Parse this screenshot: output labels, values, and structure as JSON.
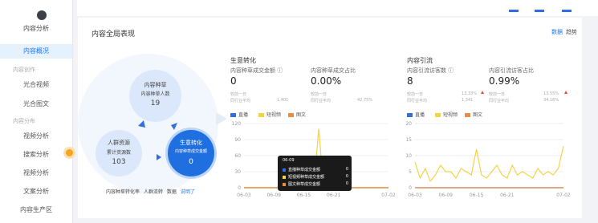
{
  "sidebar": {
    "logo_text": "内容分析",
    "items": [
      {
        "label": "内容概况",
        "active": true
      },
      {
        "group": "内容创作"
      },
      {
        "label": "光合视频"
      },
      {
        "label": "光合图文"
      },
      {
        "group": "内容分布"
      },
      {
        "label": "视频分析"
      },
      {
        "label": "搜索分析"
      },
      {
        "label": "视频分析"
      },
      {
        "label": "文案分析"
      },
      {
        "label": "内容生产区"
      }
    ]
  },
  "card": {
    "title": "内容全局表现",
    "toggle_primary": "数据",
    "toggle_secondary": "趋势"
  },
  "funnel": {
    "top": {
      "title": "内容种草",
      "subtitle": "内容种草人数",
      "value": "19"
    },
    "left": {
      "title": "人群资源",
      "subtitle": "累计资源数",
      "value": "103"
    },
    "right": {
      "title": "生意转化",
      "subtitle": "内容种草成交金额",
      "value": "0"
    },
    "footer_a": "内容种草转化率",
    "footer_b": "人群流转",
    "footer_c": "数据",
    "footer_link": "说明了"
  },
  "left_panel": {
    "section_title": "生意转化",
    "metric1_label": "内容种草成交金额 ⓘ",
    "metric1_value": "0",
    "metric2_label": "内容种草成交占比",
    "metric2_value": "0.00%",
    "sub1a": "较前一日",
    "sub1b": "同行业平均",
    "sub1c": "1,401",
    "sub2a": "较前一日",
    "sub2b": "同行业平均",
    "sub2c": "42.75%",
    "legend": [
      "直播",
      "短视频",
      "图文"
    ],
    "yticks": [
      "120",
      "90",
      "60",
      "30",
      "0"
    ],
    "xticks": [
      "06-03",
      "06-09",
      "06-15",
      "06-21",
      "07-02"
    ]
  },
  "right_panel": {
    "section_title": "内容引流",
    "metric1_label": "内容引流访客数 ⓘ",
    "metric1_value": "8",
    "metric2_label": "内容引流访客占比",
    "metric2_value": "0.99%",
    "sub1a": "较前一日",
    "sub1b": "同行业平均",
    "sub1c": "13.33%",
    "sub1d": "1,341",
    "sub2a": "较前一日",
    "sub2b": "同行业平均",
    "sub2c": "13.55%",
    "sub2d": "34.16%",
    "legend": [
      "直播",
      "短视频",
      "图文"
    ],
    "yticks": [
      "20",
      "15",
      "10",
      "5",
      "0"
    ],
    "xticks": [
      "06-03",
      "06-09",
      "06-15",
      "06-21",
      "07-02"
    ]
  },
  "tooltip": {
    "date": "06-09",
    "rows": [
      {
        "label": "直播种草成交金额",
        "value": "0"
      },
      {
        "label": "短视频种草成交金额",
        "value": "0"
      },
      {
        "label": "图文种草成交金额",
        "value": "0"
      }
    ]
  },
  "colors": {
    "blue": "#2f6fe4",
    "yellow": "#f2d34a",
    "orange": "#f08a3c",
    "active_bg": "#e6f1fe"
  },
  "chart_data": [
    {
      "type": "line",
      "title": "",
      "x": [
        "06-03",
        "06-04",
        "06-05",
        "06-06",
        "06-07",
        "06-08",
        "06-09",
        "06-10",
        "06-11",
        "06-12",
        "06-13",
        "06-14",
        "06-15",
        "06-16",
        "06-17",
        "06-18",
        "06-19",
        "06-20",
        "06-21",
        "06-22",
        "06-23",
        "06-24",
        "06-25",
        "06-26",
        "06-27",
        "06-28",
        "06-29",
        "06-30",
        "07-01",
        "07-02"
      ],
      "ylim": [
        0,
        120
      ],
      "series": [
        {
          "name": "直播",
          "values": [
            0,
            0,
            0,
            0,
            0,
            0,
            0,
            0,
            0,
            0,
            0,
            0,
            0,
            0,
            0,
            0,
            0,
            0,
            0,
            0,
            0,
            0,
            0,
            0,
            0,
            0,
            0,
            0,
            0,
            0
          ]
        },
        {
          "name": "短视频",
          "values": [
            0,
            0,
            0,
            0,
            0,
            0,
            0,
            0,
            0,
            0,
            0,
            0,
            0,
            0,
            0,
            110,
            0,
            0,
            0,
            0,
            0,
            0,
            0,
            0,
            0,
            0,
            0,
            0,
            0,
            0
          ]
        },
        {
          "name": "图文",
          "values": [
            0,
            0,
            0,
            0,
            0,
            0,
            0,
            0,
            0,
            0,
            0,
            0,
            0,
            0,
            0,
            0,
            0,
            0,
            0,
            0,
            0,
            0,
            0,
            0,
            0,
            0,
            0,
            0,
            0,
            0
          ]
        }
      ]
    },
    {
      "type": "line",
      "title": "",
      "x": [
        "06-03",
        "06-04",
        "06-05",
        "06-06",
        "06-07",
        "06-08",
        "06-09",
        "06-10",
        "06-11",
        "06-12",
        "06-13",
        "06-14",
        "06-15",
        "06-16",
        "06-17",
        "06-18",
        "06-19",
        "06-20",
        "06-21",
        "06-22",
        "06-23",
        "06-24",
        "06-25",
        "06-26",
        "06-27",
        "06-28",
        "06-29",
        "06-30",
        "07-01",
        "07-02"
      ],
      "ylim": [
        0,
        20
      ],
      "series": [
        {
          "name": "直播",
          "values": [
            0,
            0,
            0,
            0,
            0,
            0,
            0,
            0,
            0,
            0,
            0,
            0,
            0,
            0,
            0,
            0,
            0,
            0,
            0,
            0,
            0,
            0,
            0,
            0,
            0,
            0,
            0,
            0,
            0,
            0
          ]
        },
        {
          "name": "短视频",
          "values": [
            8,
            3,
            6,
            2,
            4,
            7,
            5,
            5,
            3,
            6,
            5,
            4,
            12,
            4,
            3,
            5,
            7,
            4,
            3,
            7,
            4,
            5,
            4,
            3,
            6,
            4,
            5,
            4,
            6,
            13
          ]
        },
        {
          "name": "图文",
          "values": [
            0,
            0,
            0,
            0,
            0,
            0,
            0,
            0,
            0,
            0,
            0,
            0,
            0,
            0,
            0,
            0,
            0,
            0,
            0,
            0,
            0,
            0,
            0,
            0,
            0,
            0,
            0,
            0,
            0,
            0
          ]
        }
      ]
    }
  ]
}
